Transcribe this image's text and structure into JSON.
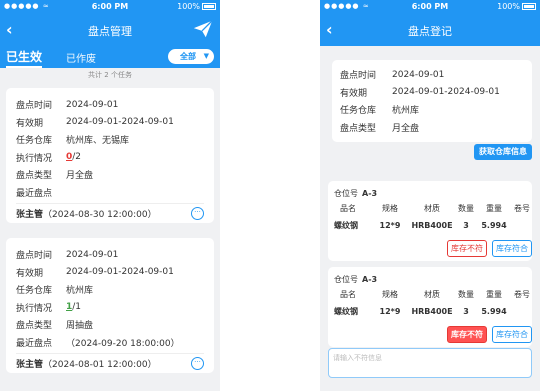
{
  "status": {
    "signal": "●●●●● ≈",
    "time": "6:00 PM",
    "battery": "100%"
  },
  "left": {
    "title": "盘点管理",
    "tabs": {
      "active": "已生效",
      "inactive": "已作废"
    },
    "filter": "全部",
    "summary": "共计 2 个任务",
    "cards": [
      {
        "rows": [
          {
            "k": "盘点时间",
            "v": "2024-09-01"
          },
          {
            "k": "有效期",
            "v": "2024-09-01-2024-09-01"
          },
          {
            "k": "任务仓库",
            "v": "杭州库、无锡库"
          }
        ],
        "progress_label": "执行情况",
        "progress_done": "0",
        "progress_total": "/2",
        "type_label": "盘点类型",
        "type": "月全盘",
        "last_label": "最近盘点",
        "last": "",
        "manager": "张主管",
        "created": "（2024-08-30 12:00:00）",
        "more": "···"
      },
      {
        "rows": [
          {
            "k": "盘点时间",
            "v": "2024-09-01"
          },
          {
            "k": "有效期",
            "v": "2024-09-01-2024-09-01"
          },
          {
            "k": "任务仓库",
            "v": "杭州库"
          }
        ],
        "progress_label": "执行情况",
        "progress_done": "1",
        "progress_total": "/1",
        "type_label": "盘点类型",
        "type": "周抽盘",
        "last_label": "最近盘点",
        "last": "（2024-09-20 18:00:00）",
        "manager": "张主管",
        "created": "（2024-08-01 12:00:00）",
        "more": "···"
      }
    ]
  },
  "right": {
    "title": "盘点登记",
    "info": [
      {
        "k": "盘点时间",
        "v": "2024-09-01"
      },
      {
        "k": "有效期",
        "v": "2024-09-01-2024-09-01"
      },
      {
        "k": "任务仓库",
        "v": "杭州库"
      },
      {
        "k": "盘点类型",
        "v": "月全盘"
      }
    ],
    "fetch_button": "获取仓库信息",
    "columns": [
      "品名",
      "规格",
      "材质",
      "数量",
      "重量",
      "卷号"
    ],
    "locations": [
      {
        "loc_label": "仓位号",
        "loc": "A-3",
        "cells": [
          "螺纹钢",
          "12*9",
          "HRB400E",
          "3",
          "5.994",
          ""
        ],
        "btn_out": "库存不符",
        "btn_in": "库存符合",
        "selected": "none"
      },
      {
        "loc_label": "仓位号",
        "loc": "A-3",
        "cells": [
          "螺纹钢",
          "12*9",
          "HRB400E",
          "3",
          "5.994",
          ""
        ],
        "btn_out": "库存不符",
        "btn_in": "库存符合",
        "selected": "out"
      }
    ],
    "remark_placeholder": "请输入不符信息"
  },
  "colors": {
    "primary": "#2196f3",
    "danger": "#e53935",
    "success": "#43a047"
  },
  "icons": {
    "back": "chevron-left-icon",
    "send": "paper-plane-icon",
    "more": "ellipsis-circle-icon"
  }
}
